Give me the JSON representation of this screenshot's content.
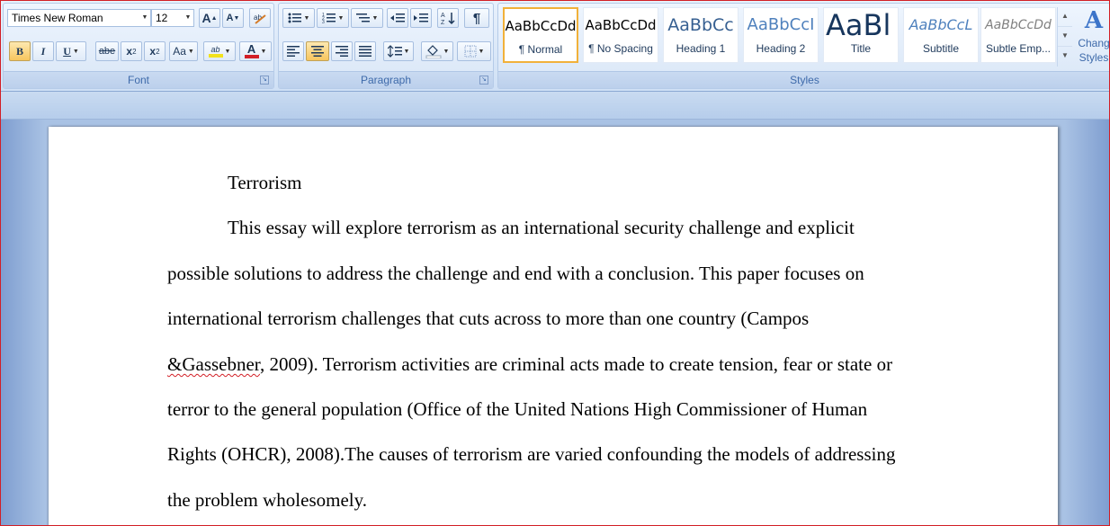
{
  "font_group": {
    "caption": "Font",
    "font_name": "Times New Roman",
    "font_size": "12",
    "grow_label": "A",
    "shrink_label": "A",
    "bold": "B",
    "italic": "I",
    "underline": "U",
    "strikethrough": "abe",
    "subscript": "x",
    "superscript": "x",
    "change_case": "Aa",
    "highlight_label": "ab",
    "font_color_label": "A"
  },
  "paragraph_group": {
    "caption": "Paragraph",
    "show_marks": "¶"
  },
  "styles_group": {
    "caption": "Styles",
    "tiles": [
      {
        "sample": "AaBbCcDd",
        "name": "¶ Normal"
      },
      {
        "sample": "AaBbCcDd",
        "name": "¶ No Spacing"
      },
      {
        "sample": "AaBbCc",
        "name": "Heading 1"
      },
      {
        "sample": "AaBbCcI",
        "name": "Heading 2"
      },
      {
        "sample": "AaBl",
        "name": "Title"
      },
      {
        "sample": "AaBbCcL",
        "name": "Subtitle"
      },
      {
        "sample": "AaBbCcDd",
        "name": "Subtle Emp..."
      }
    ],
    "change_styles_label_1": "Chang",
    "change_styles_label_2": "Styles"
  },
  "colors": {
    "highlight": "#f2e21b",
    "font_color": "#d21f26",
    "selection_border": "#f1b13a"
  },
  "document": {
    "heading": "Terrorism",
    "lines": [
      "This essay will explore terrorism as an international security challenge and explicit",
      "possible solutions to address the challenge and end with a conclusion. This paper focuses on",
      "international terrorism challenges that cuts across to more than one country (Campos",
      "&Gassebner",
      ", 2009). Terrorism activities are criminal acts made to create tension, fear or state or",
      "terror to the general population (Office of the United Nations High Commissioner of Human",
      "Rights (OHCR), 2008).The causes of terrorism are varied confounding the models of addressing",
      "the problem wholesomely."
    ]
  }
}
